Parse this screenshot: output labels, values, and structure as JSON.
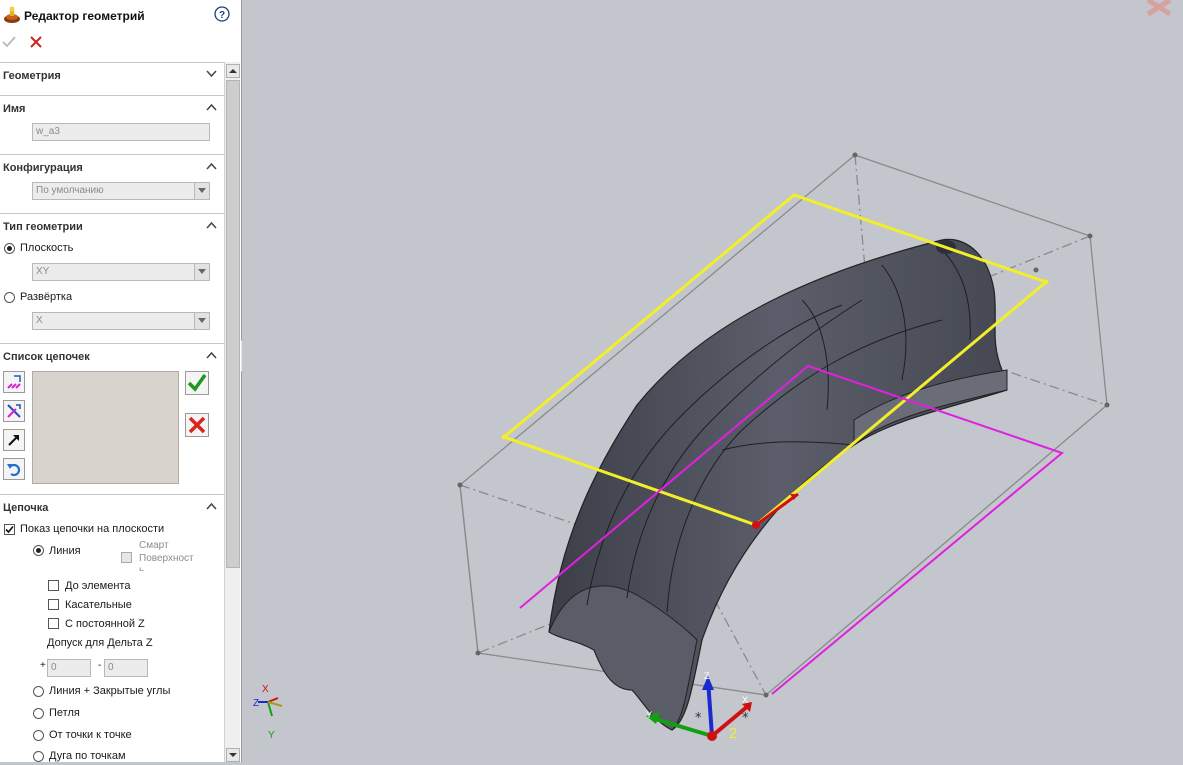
{
  "header": {
    "title": "Редактор геометрий",
    "icons": {
      "app": "geometry-editor-icon",
      "help": "help-icon",
      "ok": "checkmark-icon",
      "cancel": "close-icon"
    }
  },
  "sections": {
    "geometry": {
      "title": "Геометрия"
    },
    "name": {
      "title": "Имя",
      "value": "w_a3"
    },
    "configuration": {
      "title": "Конфигурация",
      "selected": "По умолчанию"
    },
    "geometry_type": {
      "title": "Тип геометрии",
      "plane_label": "Плоскость",
      "plane_value": "XY",
      "unwrap_label": "Развёртка",
      "unwrap_value": "X"
    },
    "chain_list": {
      "title": "Список цепочек"
    },
    "chain": {
      "title": "Цепочка",
      "show_on_plane": "Показ цепочки на плоскости",
      "line": "Линия",
      "smart_surface_1": "Смарт",
      "smart_surface_2": "Поверхност",
      "smart_surface_3": "ь",
      "to_element": "До элемента",
      "tangent": "Касательные",
      "constant_z": "С постоянной Z",
      "delta_z_label": "Допуск для Дельта Z",
      "delta_plus_sign": "+",
      "delta_plus": "0",
      "delta_minus_sign": "-",
      "delta_minus": "0",
      "line_closed_corners": "Линия + Закрытые углы",
      "loop": "Петля",
      "point_to_point": "От точки к точке",
      "arc_by_points": "Дуга по точкам"
    }
  },
  "viewport": {
    "triad_labels": {
      "x": "X",
      "y": "Y",
      "z": "Z"
    },
    "origin_labels": {
      "z": "Z",
      "y": "Y",
      "x": "X",
      "num": "2"
    },
    "colors": {
      "background": "#c3c6cc",
      "part": "#4a4d57",
      "plane_yellow": "#f2ef2a",
      "plane_magenta": "#e020e0",
      "bbox": "#888888"
    }
  }
}
